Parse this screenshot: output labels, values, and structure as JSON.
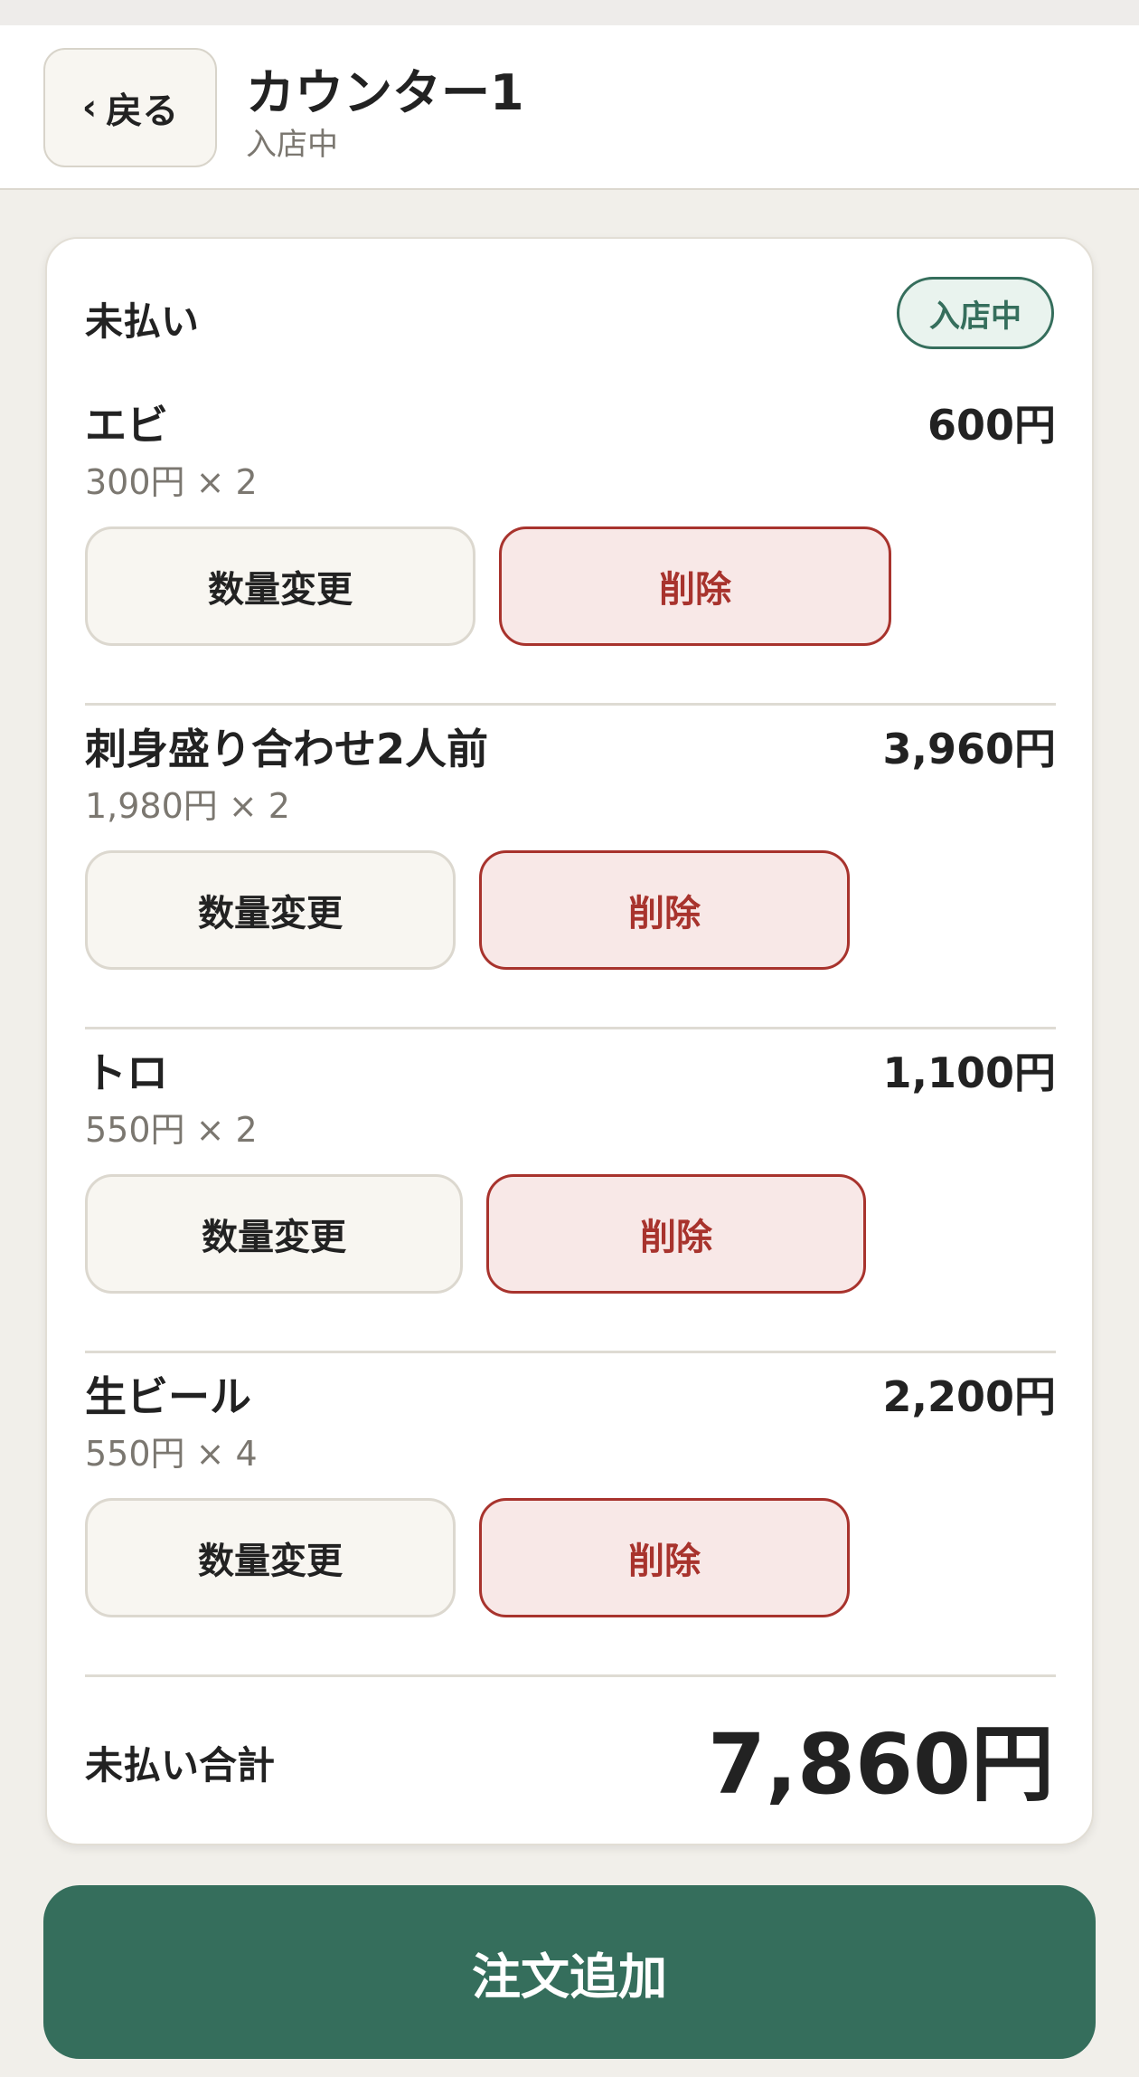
{
  "header": {
    "back_label": "戻る",
    "back_chevron": "‹",
    "title": "カウンター1",
    "subtitle": "入店中"
  },
  "card": {
    "heading": "未払い",
    "badge": "入店中",
    "items": [
      {
        "name": "エビ",
        "unit": "300円 × 2",
        "price": "600円",
        "qty_label": "数量変更",
        "delete_label": "削除"
      },
      {
        "name": "刺身盛り合わせ2人前",
        "unit": "1,980円 × 2",
        "price": "3,960円",
        "qty_label": "数量変更",
        "delete_label": "削除"
      },
      {
        "name": "トロ",
        "unit": "550円 × 2",
        "price": "1,100円",
        "qty_label": "数量変更",
        "delete_label": "削除"
      },
      {
        "name": "生ビール",
        "unit": "550円 × 4",
        "price": "2,200円",
        "qty_label": "数量変更",
        "delete_label": "削除"
      }
    ],
    "total_label": "未払い合計",
    "total_value": "7,860円"
  },
  "footer": {
    "add_order_label": "注文追加"
  },
  "colors": {
    "accent": "#356e5c",
    "danger": "#a8332d",
    "danger_bg": "#f8e8e7",
    "background": "#f1efea"
  }
}
